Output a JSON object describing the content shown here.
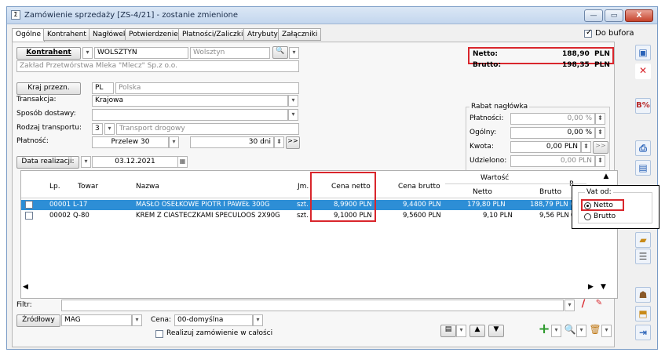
{
  "window": {
    "title": "Zamówienie sprzedaży [ZS-4/21] - zostanie zmienione",
    "min": "—",
    "max": "▭",
    "close": "X"
  },
  "tabs": [
    "Ogólne",
    "Kontrahent",
    "Nagłówek",
    "Potwierdzenie",
    "Płatności/Zaliczki",
    "Atrybuty",
    "Załączniki"
  ],
  "do_bufora": "Do bufora",
  "kontrahent": {
    "button": "Kontrahent",
    "code": "WOLSZTYN",
    "city": "Wolsztyn",
    "name": "Zakład Przetwórstwa Mleka \"Mlecz\" Sp.z o.o."
  },
  "kraj": {
    "button": "Kraj przezn.",
    "code": "PL",
    "name": "Polska"
  },
  "transakcja": {
    "label": "Transakcja:",
    "value": "Krajowa"
  },
  "sposob": {
    "label": "Sposób dostawy:",
    "value": ""
  },
  "transport": {
    "label": "Rodzaj transportu:",
    "code": "3",
    "value": "Transport drogowy"
  },
  "platnosc": {
    "label": "Płatność:",
    "value": "Przelew 30",
    "days": "30 dni",
    "arrows": ">>"
  },
  "data_realizacji": {
    "button": "Data realizacji:",
    "value": "03.12.2021"
  },
  "totals": {
    "netto_label": "Netto:",
    "netto_value": "188,90",
    "netto_cur": "PLN",
    "brutto_label": "Brutto:",
    "brutto_value": "198,35",
    "brutto_cur": "PLN"
  },
  "rabat": {
    "title": "Rabat nagłówka",
    "platnosci_label": "Płatności:",
    "platnosci": "0,00 %",
    "ogolny_label": "Ogólny:",
    "ogolny": "0,00 %",
    "kwota_label": "Kwota:",
    "kwota": "0,00 PLN",
    "kwota_arrows": ">>",
    "udzielono_label": "Udzielono:",
    "udzielono": "0,00 PLN"
  },
  "grid": {
    "headers": {
      "lp": "Lp.",
      "towar": "Towar",
      "nazwa": "Nazwa",
      "jm": "Jm.",
      "cena_netto": "Cena netto",
      "cena_brutto": "Cena brutto",
      "wartosc": "Wartość",
      "netto": "Netto",
      "brutto": "Brutto",
      "r": "R"
    },
    "rows": [
      {
        "lp": "00001",
        "towar": "L-17",
        "nazwa": "MASŁO OSEŁKOWE PIOTR I PAWEŁ 300G",
        "jm": "szt.",
        "cena_netto": "8,9900 PLN",
        "cena_brutto": "9,4400 PLN",
        "netto": "179,80 PLN",
        "brutto": "188,79 PLN",
        "r": "0,"
      },
      {
        "lp": "00002",
        "towar": "Q-80",
        "nazwa": "KREM Z CIASTECZKAMI SPECULOOS 2X90G",
        "jm": "szt.",
        "cena_netto": "9,1000 PLN",
        "cena_brutto": "9,5600 PLN",
        "netto": "9,10 PLN",
        "brutto": "9,56 PLN",
        "r": "0,"
      }
    ]
  },
  "vat": {
    "title": "Vat od:",
    "netto": "Netto",
    "brutto": "Brutto"
  },
  "filtr": {
    "label": "Filtr:",
    "value": ""
  },
  "zrodlowy": {
    "button": "Źródłowy",
    "value": "MAG"
  },
  "cena": {
    "label": "Cena:",
    "value": "00-domyślna"
  },
  "realizuj": "Realizuj zamówienie w całości",
  "colors": {
    "accent": "#2d8ed6",
    "highlight": "#d9262c"
  }
}
